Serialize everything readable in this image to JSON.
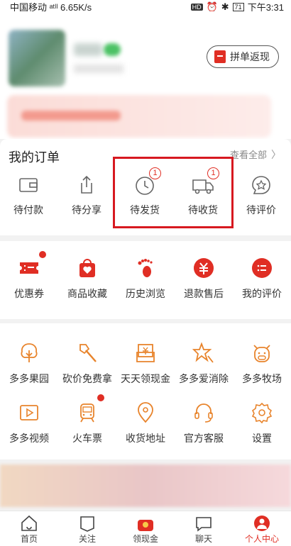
{
  "status_bar": {
    "left": "中国移动 ᵃᵗˡˡ 6.65K/s",
    "hd": "HD",
    "battery": "71",
    "time": "下午3:31"
  },
  "header": {
    "group_return_label": "拼单返现"
  },
  "orders": {
    "title": "我的订单",
    "view_all": "查看全部",
    "items": [
      {
        "label": "待付款",
        "icon": "wallet-icon"
      },
      {
        "label": "待分享",
        "icon": "share-icon"
      },
      {
        "label": "待发货",
        "icon": "clock-icon",
        "badge": "1"
      },
      {
        "label": "待收货",
        "icon": "truck-icon",
        "badge": "1"
      },
      {
        "label": "待评价",
        "icon": "review-icon"
      }
    ]
  },
  "services": {
    "items": [
      {
        "label": "优惠券",
        "icon": "coupon-icon",
        "dot": true
      },
      {
        "label": "商品收藏",
        "icon": "favorites-bag-icon"
      },
      {
        "label": "历史浏览",
        "icon": "footprint-icon"
      },
      {
        "label": "退款售后",
        "icon": "refund-icon"
      },
      {
        "label": "我的评价",
        "icon": "my-review-icon"
      }
    ]
  },
  "tools": {
    "items": [
      {
        "label": "多多果园",
        "icon": "tree-icon"
      },
      {
        "label": "砍价免费拿",
        "icon": "axe-icon"
      },
      {
        "label": "天天领现金",
        "icon": "cash-icon"
      },
      {
        "label": "多多爱消除",
        "icon": "star-icon"
      },
      {
        "label": "多多牧场",
        "icon": "cow-icon"
      },
      {
        "label": "多多视频",
        "icon": "video-icon"
      },
      {
        "label": "火车票",
        "icon": "train-icon",
        "dot": true
      },
      {
        "label": "收货地址",
        "icon": "location-icon"
      },
      {
        "label": "官方客服",
        "icon": "headset-icon"
      },
      {
        "label": "设置",
        "icon": "settings-gear-icon"
      }
    ]
  },
  "tabbar": {
    "items": [
      {
        "label": "首页",
        "icon": "home-icon"
      },
      {
        "label": "关注",
        "icon": "follow-icon"
      },
      {
        "label": "领现金",
        "icon": "cash-tab-icon"
      },
      {
        "label": "聊天",
        "icon": "chat-icon"
      },
      {
        "label": "个人中心",
        "icon": "profile-icon",
        "active": true
      }
    ]
  },
  "colors": {
    "accent": "#e02e24",
    "highlight_box": "#d71920",
    "icon_orange": "#e8842c"
  }
}
